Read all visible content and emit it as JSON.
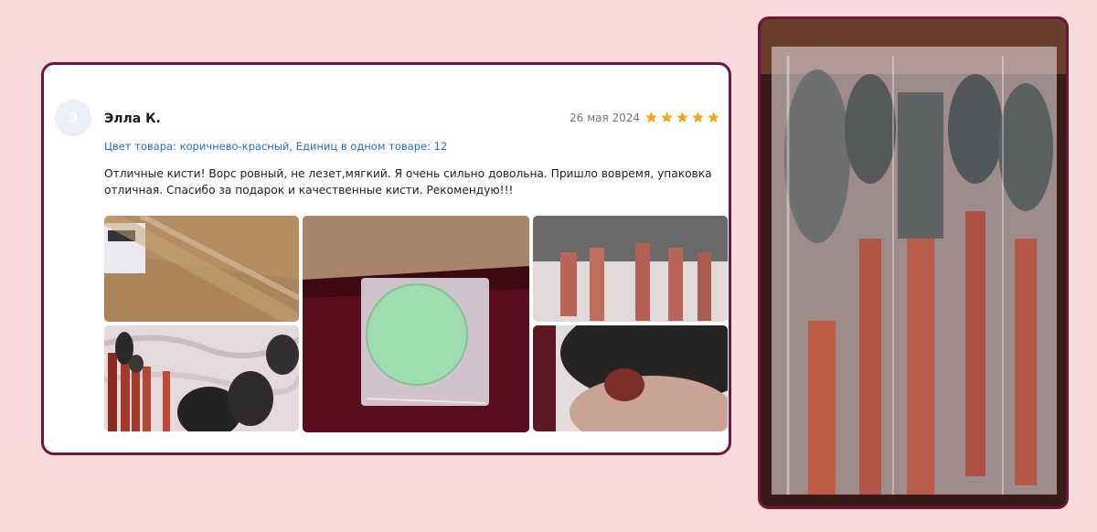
{
  "review": {
    "avatar_letter": "Э",
    "author": "Элла К.",
    "date": "26 мая 2024",
    "rating": 5,
    "product_meta": "Цвет товара: коричнево-красный, Единиц в одном товаре: 12",
    "text": "Отличные кисти! Ворс ровный, не лезет,мягкий. Я очень сильно довольна. Пришло вовремя, упаковка отличная. Спасибо за подарок и качественные кисти. Рекомендую!!!"
  },
  "colors": {
    "page_bg": "#f7dada",
    "card_border": "#6e1640",
    "star": "#f5a41b",
    "meta_link": "#1f6fd1"
  },
  "photos": [
    {
      "name": "cardboard-package-photo"
    },
    {
      "name": "sponge-in-bag-photo"
    },
    {
      "name": "wrapped-brushes-photo"
    },
    {
      "name": "brushes-on-fabric-photo"
    },
    {
      "name": "brush-touch-hand-photo"
    }
  ],
  "side_photo": {
    "name": "brushes-package-closeup-photo"
  }
}
